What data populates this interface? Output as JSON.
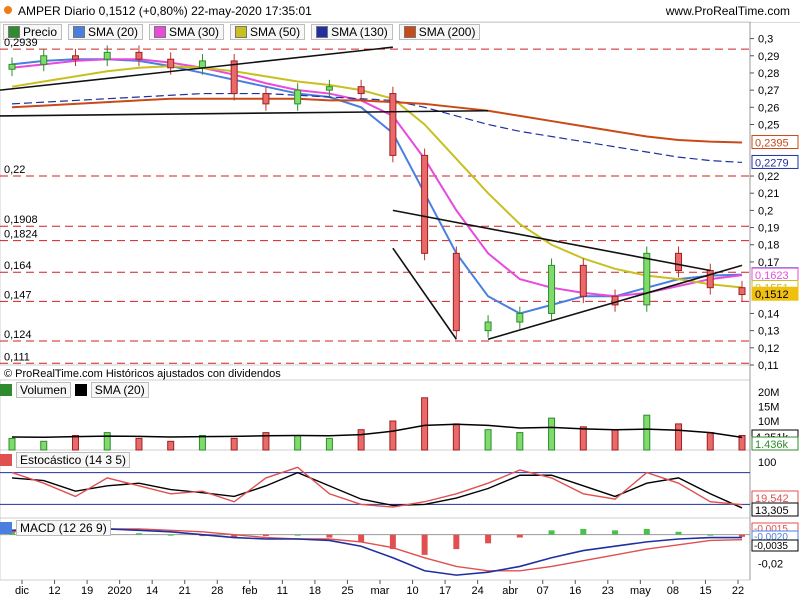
{
  "header": {
    "title": "AMPER Diario 0,1512 (+0,80%) 22-may-2020 17:35:01",
    "site": "www.ProRealTime.com"
  },
  "price_panel": {
    "legend": [
      {
        "name": "Precio",
        "color": "#2e8b2e"
      },
      {
        "name": "SMA (20)",
        "color": "#4a7fe0"
      },
      {
        "name": "SMA (30)",
        "color": "#e84adc"
      },
      {
        "name": "SMA (50)",
        "color": "#c8c020"
      },
      {
        "name": "SMA (130)",
        "color": "#2030a0"
      },
      {
        "name": "SMA (200)",
        "color": "#c84a18"
      }
    ],
    "copyright": "© ProRealTime.com  Históricos ajustados con dividendos",
    "left_levels": [
      "0,2939",
      "0,22",
      "0,1908",
      "0,1824",
      "0,164",
      "0,147",
      "0,124",
      "0,111"
    ],
    "axis_ticks": [
      "0,3",
      "0,29",
      "0,28",
      "0,27",
      "0,26",
      "0,25",
      "0,22",
      "0,21",
      "0,2",
      "0,19",
      "0,18",
      "0,17",
      "0,14",
      "0,13",
      "0,12",
      "0,11"
    ],
    "right_labels": [
      {
        "text": "0,2395",
        "color": "#c84a18"
      },
      {
        "text": "0,2279",
        "color": "#2030a0"
      },
      {
        "text": "0,1626",
        "color": "#4a7fe0"
      },
      {
        "text": "0,1623",
        "color": "#e84adc"
      },
      {
        "text": "0,1551",
        "color": "#c8c020"
      },
      {
        "text": "0,1512",
        "color": "#f0c010"
      }
    ]
  },
  "volume_panel": {
    "label": "Volumen",
    "sma_label": "SMA (20)",
    "axis_ticks": [
      "20M",
      "15M",
      "10M",
      "5M"
    ],
    "right_labels": [
      {
        "text": "4.351k",
        "color": "#000000"
      },
      {
        "text": "1.436k",
        "color": "#2e8b2e"
      }
    ]
  },
  "stoch_panel": {
    "label": "Estocástico (14 3 5)",
    "axis_ticks": [
      "100",
      "0"
    ],
    "right_labels": [
      {
        "text": "19,542",
        "color": "#e05050"
      },
      {
        "text": "13,305",
        "color": "#000000"
      }
    ]
  },
  "macd_panel": {
    "label": "MACD (12 26 9)",
    "axis_ticks": [
      "-0,02"
    ],
    "right_labels": [
      {
        "text": "-0,0015",
        "color": "#e05050"
      },
      {
        "text": "-0,0020",
        "color": "#4a7fe0"
      },
      {
        "text": "-0,0035",
        "color": "#000000"
      }
    ]
  },
  "x_axis": [
    "dic",
    "12",
    "19",
    "2020",
    "14",
    "21",
    "28",
    "feb",
    "11",
    "18",
    "25",
    "mar",
    "10",
    "17",
    "24",
    "abr",
    "07",
    "16",
    "23",
    "may",
    "08",
    "15",
    "22"
  ],
  "chart_data": {
    "type": "candlestick",
    "title": "AMPER Diario 0,1512 (+0,80%) 22-may-2020 17:35:01",
    "x_categories": [
      "dic",
      "12",
      "19",
      "2020",
      "14",
      "21",
      "28",
      "feb",
      "11",
      "18",
      "25",
      "mar",
      "10",
      "17",
      "24",
      "abr",
      "07",
      "16",
      "23",
      "may",
      "08",
      "15",
      "22"
    ],
    "close": [
      0.285,
      0.29,
      0.288,
      0.292,
      0.288,
      0.283,
      0.287,
      0.268,
      0.262,
      0.27,
      0.272,
      0.268,
      0.232,
      0.175,
      0.13,
      0.135,
      0.14,
      0.168,
      0.15,
      0.145,
      0.175,
      0.165,
      0.155,
      0.151
    ],
    "series": [
      {
        "name": "SMA (20)",
        "values": [
          0.285,
          0.287,
          0.288,
          0.288,
          0.287,
          0.284,
          0.28,
          0.276,
          0.272,
          0.268,
          0.266,
          0.26,
          0.245,
          0.21,
          0.175,
          0.15,
          0.14,
          0.145,
          0.15,
          0.15,
          0.155,
          0.16,
          0.162,
          0.1626
        ]
      },
      {
        "name": "SMA (30)",
        "values": [
          0.283,
          0.285,
          0.287,
          0.288,
          0.288,
          0.286,
          0.283,
          0.279,
          0.274,
          0.27,
          0.268,
          0.264,
          0.255,
          0.23,
          0.2,
          0.175,
          0.16,
          0.155,
          0.152,
          0.15,
          0.152,
          0.156,
          0.16,
          0.1623
        ]
      },
      {
        "name": "SMA (50)",
        "values": [
          0.272,
          0.275,
          0.278,
          0.281,
          0.283,
          0.284,
          0.283,
          0.281,
          0.278,
          0.275,
          0.273,
          0.27,
          0.265,
          0.25,
          0.23,
          0.21,
          0.192,
          0.18,
          0.172,
          0.166,
          0.162,
          0.16,
          0.157,
          0.1551
        ]
      },
      {
        "name": "SMA (130)",
        "values": [
          0.262,
          0.263,
          0.264,
          0.265,
          0.266,
          0.267,
          0.268,
          0.268,
          0.268,
          0.267,
          0.266,
          0.265,
          0.264,
          0.26,
          0.255,
          0.25,
          0.246,
          0.243,
          0.24,
          0.237,
          0.234,
          0.231,
          0.229,
          0.2279
        ]
      },
      {
        "name": "SMA (200)",
        "values": [
          0.26,
          0.261,
          0.262,
          0.263,
          0.264,
          0.265,
          0.265,
          0.265,
          0.265,
          0.265,
          0.264,
          0.264,
          0.263,
          0.262,
          0.26,
          0.258,
          0.255,
          0.252,
          0.249,
          0.246,
          0.243,
          0.241,
          0.24,
          0.2395
        ]
      }
    ],
    "volume": [
      4,
      3,
      5,
      6,
      4,
      3,
      5,
      4,
      6,
      5,
      4,
      7,
      10,
      18,
      9,
      7,
      6,
      11,
      8,
      7,
      12,
      9,
      6,
      5
    ],
    "volume_sma": [
      4.5,
      4.4,
      4.6,
      4.8,
      4.7,
      4.5,
      4.6,
      4.7,
      4.9,
      5.0,
      4.9,
      5.3,
      6.5,
      8.5,
      8.9,
      8.5,
      7.6,
      7.8,
      7.3,
      7.0,
      7.2,
      6.8,
      6.0,
      4.35
    ],
    "stoch_k": [
      80,
      60,
      35,
      70,
      55,
      40,
      45,
      25,
      70,
      90,
      40,
      20,
      15,
      25,
      40,
      60,
      85,
      70,
      40,
      30,
      80,
      60,
      25,
      19.5
    ],
    "stoch_d": [
      70,
      65,
      45,
      55,
      60,
      48,
      42,
      35,
      55,
      80,
      55,
      30,
      18,
      20,
      32,
      50,
      75,
      75,
      55,
      35,
      60,
      70,
      40,
      13.3
    ],
    "macd_hist": [
      0.002,
      0.003,
      0.001,
      0.002,
      0.001,
      0.0,
      -0.001,
      -0.002,
      -0.001,
      0.0,
      -0.002,
      -0.005,
      -0.01,
      -0.014,
      -0.01,
      -0.006,
      -0.002,
      0.003,
      0.004,
      0.003,
      0.004,
      0.002,
      0.0,
      -0.0015
    ],
    "macd_line": [
      0.003,
      0.004,
      0.004,
      0.004,
      0.003,
      0.002,
      0.0,
      -0.002,
      -0.003,
      -0.003,
      -0.004,
      -0.008,
      -0.016,
      -0.025,
      -0.028,
      -0.026,
      -0.022,
      -0.016,
      -0.011,
      -0.008,
      -0.005,
      -0.003,
      -0.002,
      -0.002
    ],
    "macd_signal": [
      0.002,
      0.003,
      0.004,
      0.004,
      0.004,
      0.003,
      0.002,
      0.0,
      -0.002,
      -0.003,
      -0.003,
      -0.005,
      -0.009,
      -0.016,
      -0.022,
      -0.025,
      -0.025,
      -0.022,
      -0.018,
      -0.014,
      -0.01,
      -0.007,
      -0.004,
      -0.0035
    ],
    "ylim": [
      0.11,
      0.305
    ]
  }
}
